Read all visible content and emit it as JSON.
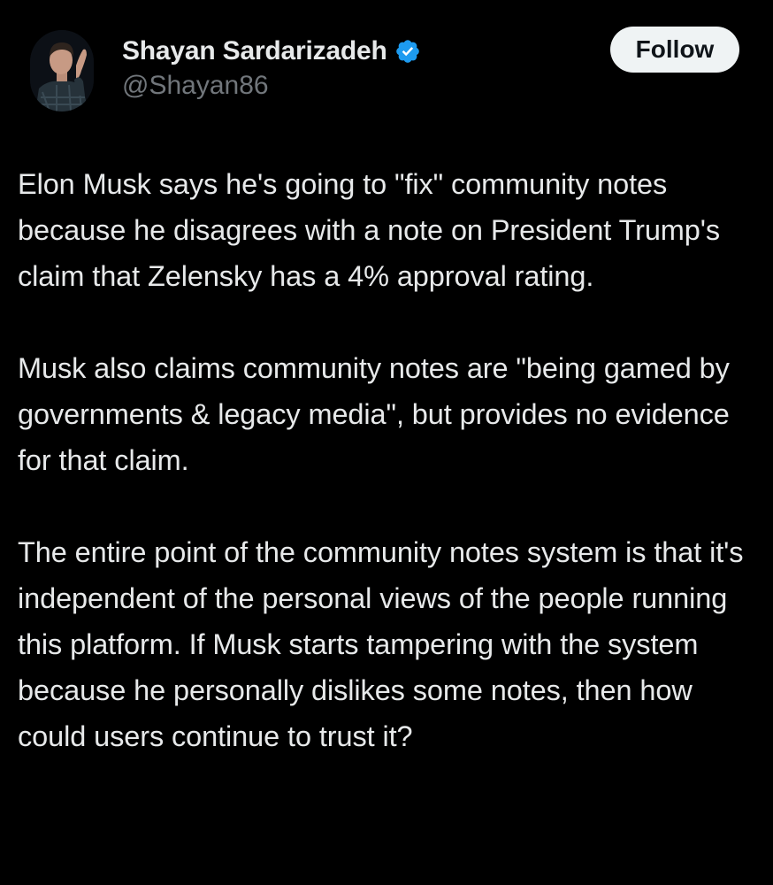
{
  "author": {
    "display_name": "Shayan Sardarizadeh",
    "handle": "@Shayan86",
    "verified": true,
    "avatar_icon": "user-avatar-photo",
    "verified_icon": "verified-badge-icon",
    "verified_color": "#1d9bf0"
  },
  "follow_button": {
    "label": "Follow"
  },
  "tweet": {
    "paragraphs": [
      "Elon Musk says he's going to \"fix\" community notes because he disagrees with a note on President Trump's claim that Zelensky has a 4% approval rating.",
      "Musk also claims community notes are \"being gamed by governments & legacy media\", but provides no evidence for that claim.",
      "The entire point of the community notes system is that it's independent of the personal views of the people running this platform. If Musk starts tampering with the system because he personally dislikes some notes, then how could users continue to trust it?"
    ]
  },
  "colors": {
    "background": "#000000",
    "text_primary": "#e7e9ea",
    "text_secondary": "#71767b",
    "button_bg": "#eff3f4",
    "button_text": "#0f1419"
  }
}
